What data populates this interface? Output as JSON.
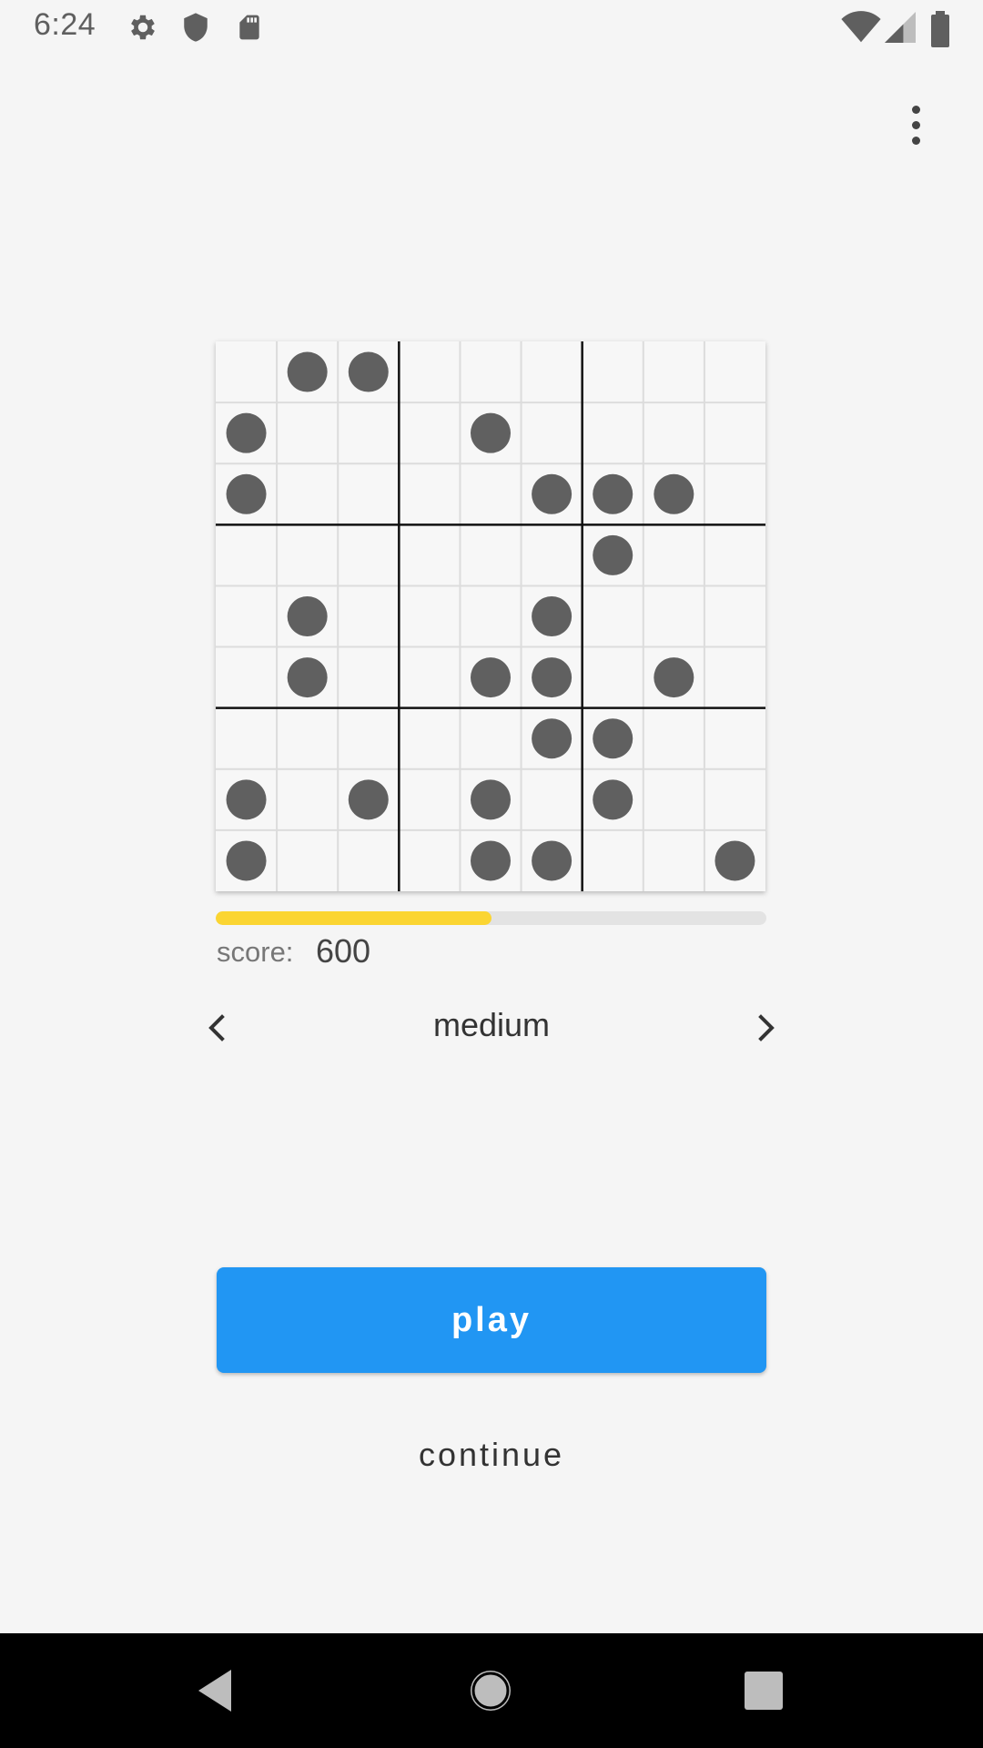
{
  "status_bar": {
    "time": "6:24",
    "left_icons": [
      "gear-icon",
      "shield-icon",
      "sd-card-icon"
    ],
    "right_icons": [
      "wifi-icon",
      "signal-icon",
      "battery-icon"
    ]
  },
  "app_bar": {
    "menu_icon": "more-vert-icon"
  },
  "board": {
    "size": 9,
    "block": 3,
    "dots": [
      [
        0,
        1,
        1,
        0,
        0,
        0,
        0,
        0,
        0
      ],
      [
        1,
        0,
        0,
        0,
        1,
        0,
        0,
        0,
        0
      ],
      [
        1,
        0,
        0,
        0,
        0,
        1,
        1,
        1,
        0
      ],
      [
        0,
        0,
        0,
        0,
        0,
        0,
        1,
        0,
        0
      ],
      [
        0,
        1,
        0,
        0,
        0,
        1,
        0,
        0,
        0
      ],
      [
        0,
        1,
        0,
        0,
        1,
        1,
        0,
        1,
        0
      ],
      [
        0,
        0,
        0,
        0,
        0,
        1,
        1,
        0,
        0
      ],
      [
        1,
        0,
        1,
        0,
        1,
        0,
        1,
        0,
        0
      ],
      [
        1,
        0,
        0,
        0,
        1,
        1,
        0,
        0,
        1
      ]
    ],
    "colors": {
      "dot": "#606060",
      "thin_line": "#dcdcdc",
      "thick_line": "#111111",
      "cell": "#f7f7f7"
    }
  },
  "progress": {
    "fraction": 0.5,
    "color": "#fbd532"
  },
  "score": {
    "label": "score:",
    "value": "600"
  },
  "difficulty": {
    "label": "medium",
    "prev_icon": "chevron-left-icon",
    "next_icon": "chevron-right-icon"
  },
  "buttons": {
    "play": "play",
    "continue": "continue",
    "play_color": "#2196f3"
  },
  "nav_bar": {
    "icons": [
      "back-icon",
      "home-icon",
      "recents-icon"
    ]
  }
}
